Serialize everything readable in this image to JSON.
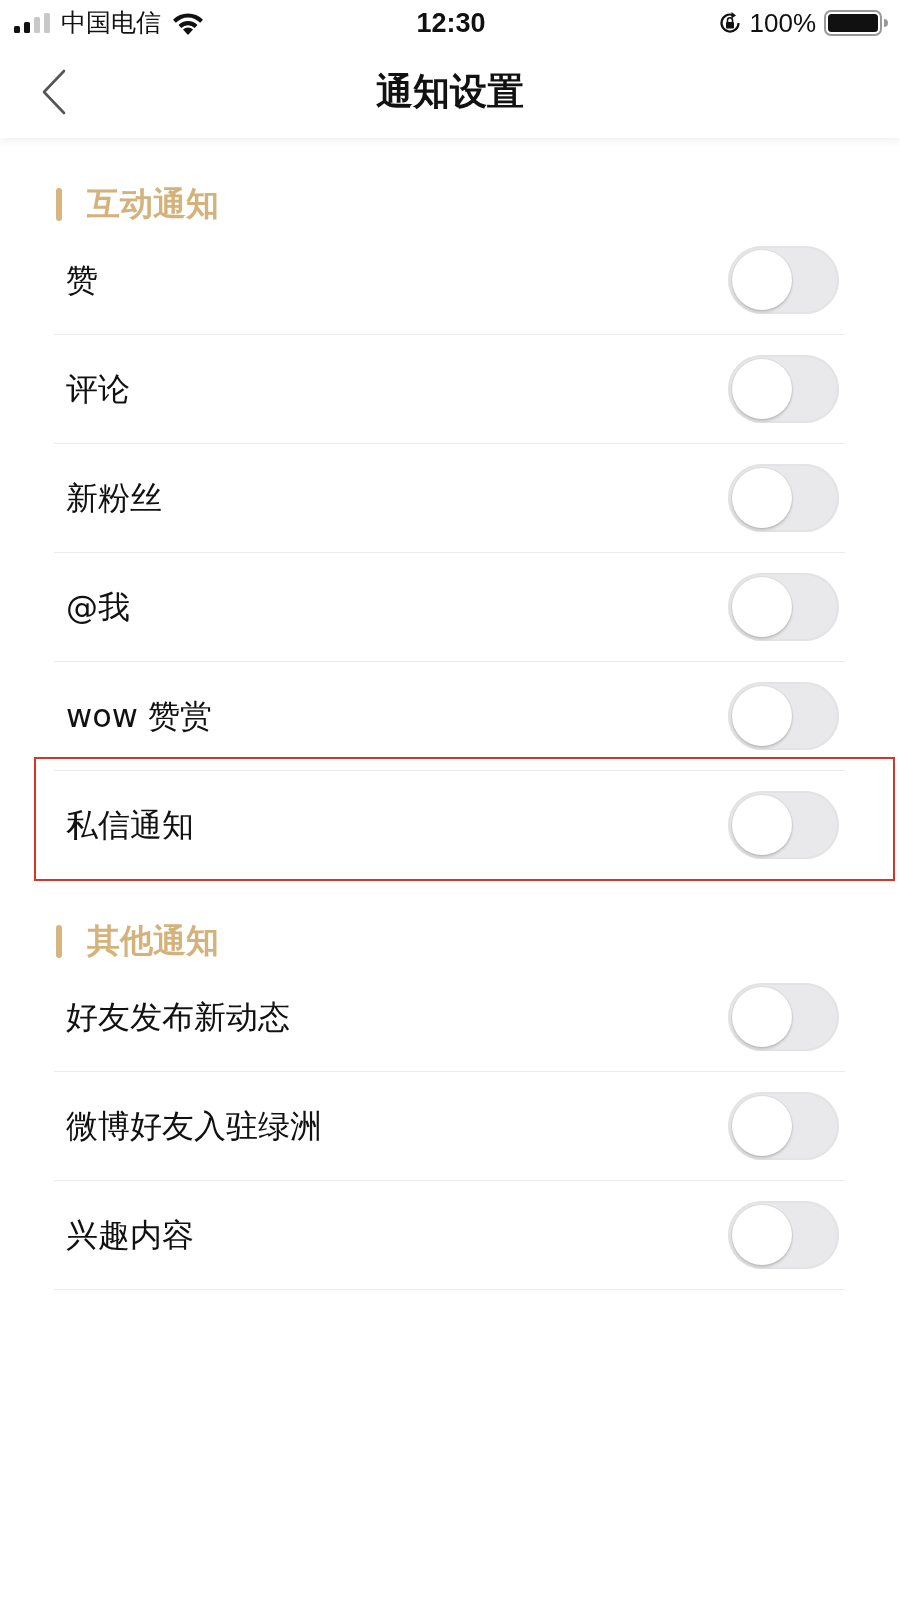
{
  "status_bar": {
    "carrier": "中国电信",
    "time": "12:30",
    "battery": "100%"
  },
  "nav": {
    "title": "通知设置"
  },
  "sections": [
    {
      "title": "互动通知",
      "rows": [
        {
          "label": "赞",
          "on": false,
          "highlighted": false
        },
        {
          "label": "评论",
          "on": false,
          "highlighted": false
        },
        {
          "label": "新粉丝",
          "on": false,
          "highlighted": false
        },
        {
          "label": "@我",
          "on": false,
          "highlighted": false
        },
        {
          "label": "wow 赞赏",
          "on": false,
          "highlighted": false
        },
        {
          "label": "私信通知",
          "on": false,
          "highlighted": true
        }
      ]
    },
    {
      "title": "其他通知",
      "rows": [
        {
          "label": "好友发布新动态",
          "on": false,
          "highlighted": false
        },
        {
          "label": "微博好友入驻绿洲",
          "on": false,
          "highlighted": false
        },
        {
          "label": "兴趣内容",
          "on": false,
          "highlighted": false
        }
      ]
    }
  ]
}
